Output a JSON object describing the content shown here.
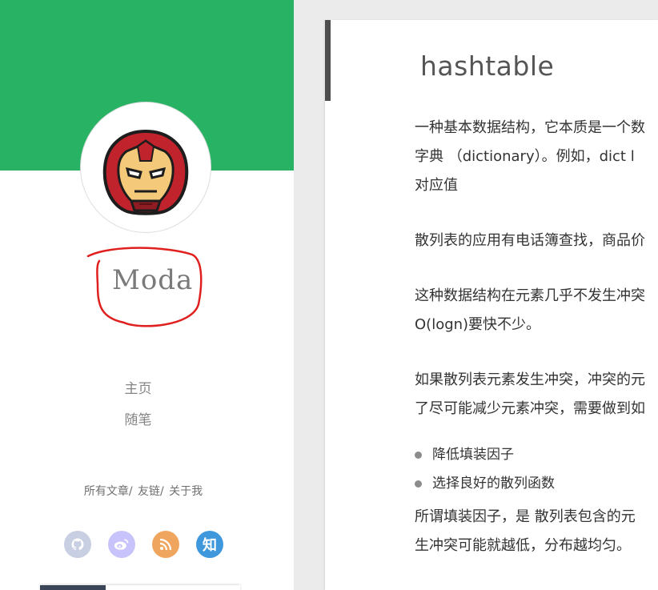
{
  "sidebar": {
    "name": "Moda",
    "nav": [
      "主页",
      "随笔"
    ],
    "links": [
      "所有文章/",
      "友链/",
      "关于我"
    ],
    "social": [
      {
        "name": "github-icon",
        "color": "#c9cfe3"
      },
      {
        "name": "weibo-icon",
        "color": "#c9c3fb"
      },
      {
        "name": "rss-icon",
        "color": "#f0a55f"
      },
      {
        "name": "zhihu-icon",
        "label": "知",
        "color": "#3f97dc"
      }
    ],
    "banner_color": "#27b264"
  },
  "article": {
    "title": "hashtable",
    "paragraphs": [
      [
        "一种基本数据结构，它本质是一个数",
        "字典 （dictionary）。例如，dict l",
        "对应值"
      ],
      [
        "散列表的应用有电话簿查找，商品价"
      ],
      [
        "这种数据结构在元素几乎不发生冲突",
        "O(logn)要快不少。"
      ],
      [
        "如果散列表元素发生冲突，冲突的元",
        "了尽可能减少元素冲突，需要做到如"
      ]
    ],
    "bullets": [
      "降低填装因子",
      "选择良好的散列函数"
    ],
    "closing": [
      "所谓填装因子，是 散列表包含的元",
      "生冲突可能就越低，分布越均匀。"
    ]
  }
}
